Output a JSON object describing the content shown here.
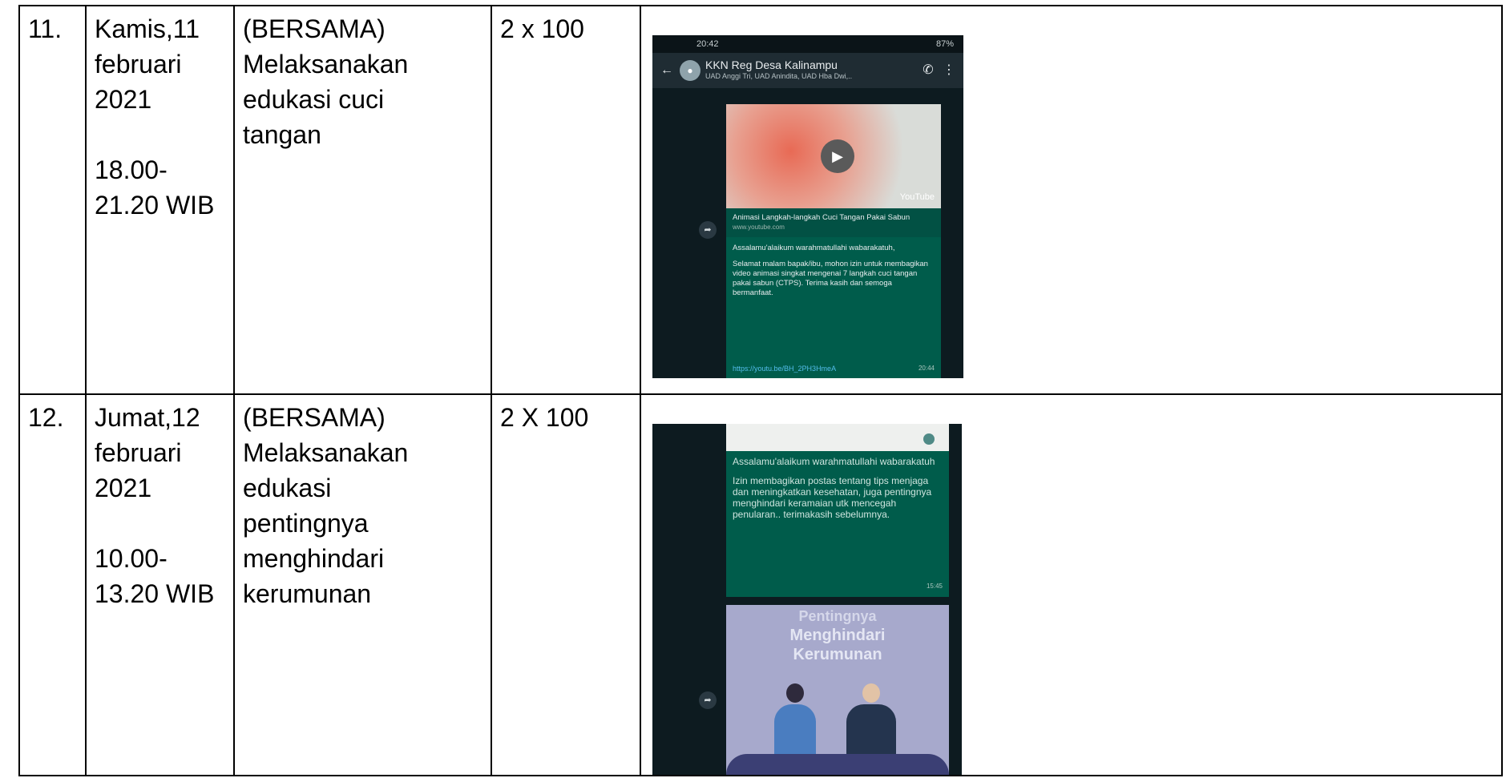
{
  "rows": [
    {
      "no": "11.",
      "date_lines": [
        "Kamis,11",
        "februari",
        "2021"
      ],
      "time_lines": [
        "18.00-",
        "21.20 WIB"
      ],
      "activity_lines": [
        "(BERSAMA)",
        "Melaksanakan",
        "edukasi cuci",
        "tangan"
      ],
      "volume": "2 x 100",
      "doc": {
        "status_time": "20:42",
        "status_right": "87%",
        "chat_title": "KKN Reg Desa Kalinampu",
        "chat_members": "UAD Anggi Tri, UAD Anindita, UAD Hba Dwi,..",
        "link_title": "Animasi Langkah-langkah Cuci Tangan Pakai Sabun",
        "link_domain": "www.youtube.com",
        "video_label": "YouTube",
        "msg1": "Assalamu'alaikum warahmatullahi wabarakatuh,",
        "msg2": "Selamat malam bapak/ibu, mohon izin untuk membagikan video animasi singkat mengenai 7 langkah cuci tangan pakai sabun (CTPS). Terima kasih dan semoga bermanfaat.",
        "url": "https://youtu.be/BH_2PH3HmeA",
        "msg_time": "20:44",
        "icons": {
          "back": "arrow-left",
          "call": "phone-plus",
          "menu": "kebab",
          "play": "play",
          "forward": "share-arrow"
        }
      }
    },
    {
      "no": "12.",
      "date_lines": [
        "Jumat,12",
        "februari",
        "2021"
      ],
      "time_lines": [
        "10.00-",
        "13.20 WIB"
      ],
      "activity_lines": [
        "(BERSAMA)",
        "Melaksanakan",
        "edukasi",
        "pentingnya",
        "menghindari",
        "kerumunan"
      ],
      "volume": "2 X 100",
      "doc": {
        "msg1": "Assalamu'alaikum warahmatullahi wabarakatuh",
        "msg2": "Izin membagikan postas tentang tips menjaga dan meningkatkan kesehatan, juga pentingnya menghindari keramaian utk mencegah penularan.. terimakasih sebelumnya.",
        "msg_time": "15:45",
        "poster_line1": "Pentingnya",
        "poster_line2": "Menghindari",
        "poster_line3": "Kerumunan",
        "icons": {
          "forward": "share-arrow"
        }
      }
    }
  ]
}
